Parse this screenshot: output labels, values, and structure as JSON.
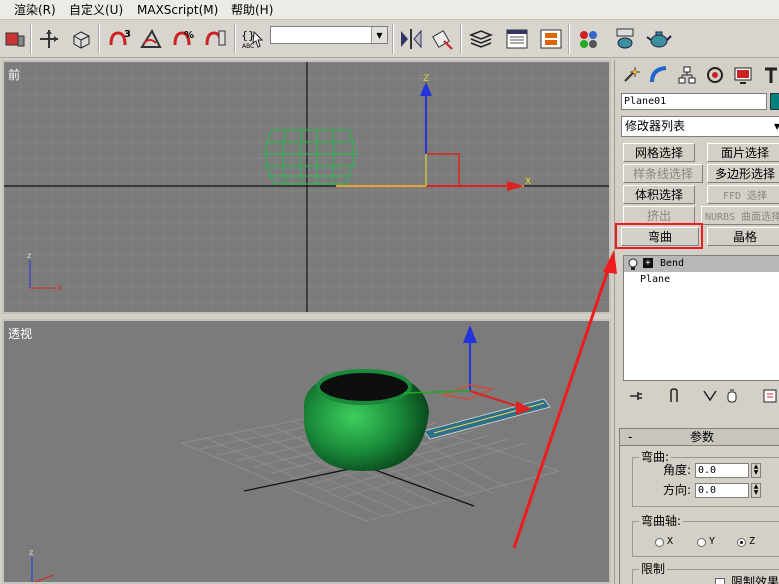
{
  "menu": {
    "items": [
      "渲染(R)",
      "自定义(U)",
      "MAXScript(M)",
      "帮助(H)"
    ]
  },
  "toolbar": {
    "icons": [
      "render-setup-icon",
      "select-move-icon",
      "select-object-icon",
      "snap-3d-icon",
      "angle-snap-icon",
      "percent-snap-icon",
      "spinner-snap-icon",
      "named-selection-icon",
      "mirror-icon",
      "align-icon",
      "layer-manager-icon",
      "curve-editor-icon",
      "schematic-view-icon",
      "material-editor-icon",
      "render-scene-icon",
      "quick-render-icon"
    ],
    "named_selection_value": ""
  },
  "viewports": {
    "front_label": "前",
    "persp_label": "透视",
    "gizmo_z": "Z",
    "gizmo_x": "X"
  },
  "command_panel": {
    "tab_icons": [
      "create-tab-icon",
      "modify-tab-icon",
      "hierarchy-tab-icon",
      "motion-tab-icon",
      "display-tab-icon",
      "utilities-tab-icon"
    ],
    "object_name": "Plane01",
    "object_color": "#008080",
    "modifier_list_label": "修改器列表",
    "modifier_buttons": [
      {
        "label": "网格选择",
        "enabled": true
      },
      {
        "label": "面片选择",
        "enabled": true
      },
      {
        "label": "样条线选择",
        "enabled": false
      },
      {
        "label": "多边形选择",
        "enabled": true
      },
      {
        "label": "体积选择",
        "enabled": true
      },
      {
        "label": "FFD 选择",
        "enabled": false
      },
      {
        "label": "挤出",
        "enabled": false
      },
      {
        "label": "NURBS 曲面选择",
        "enabled": false
      },
      {
        "label": "弯曲",
        "enabled": true
      },
      {
        "label": "晶格",
        "enabled": true
      }
    ],
    "stack": [
      {
        "label": "Bend",
        "selected": true
      },
      {
        "label": "Plane",
        "selected": false
      }
    ],
    "rollout_title": "参数",
    "bend_group_title": "弯曲:",
    "angle_label": "角度:",
    "angle_value": "0.0",
    "direction_label": "方向:",
    "direction_value": "0.0",
    "axis_group_title": "弯曲轴:",
    "axes": [
      {
        "label": "X",
        "checked": false
      },
      {
        "label": "Y",
        "checked": false
      },
      {
        "label": "Z",
        "checked": true
      }
    ],
    "limit_group_title": "限制",
    "limit_effect_label": "限制效果"
  },
  "colors": {
    "viewport_bg": "#7b7b7b",
    "highlight_red": "#ee1c1c",
    "teapot_green": "#1a8a3a"
  }
}
